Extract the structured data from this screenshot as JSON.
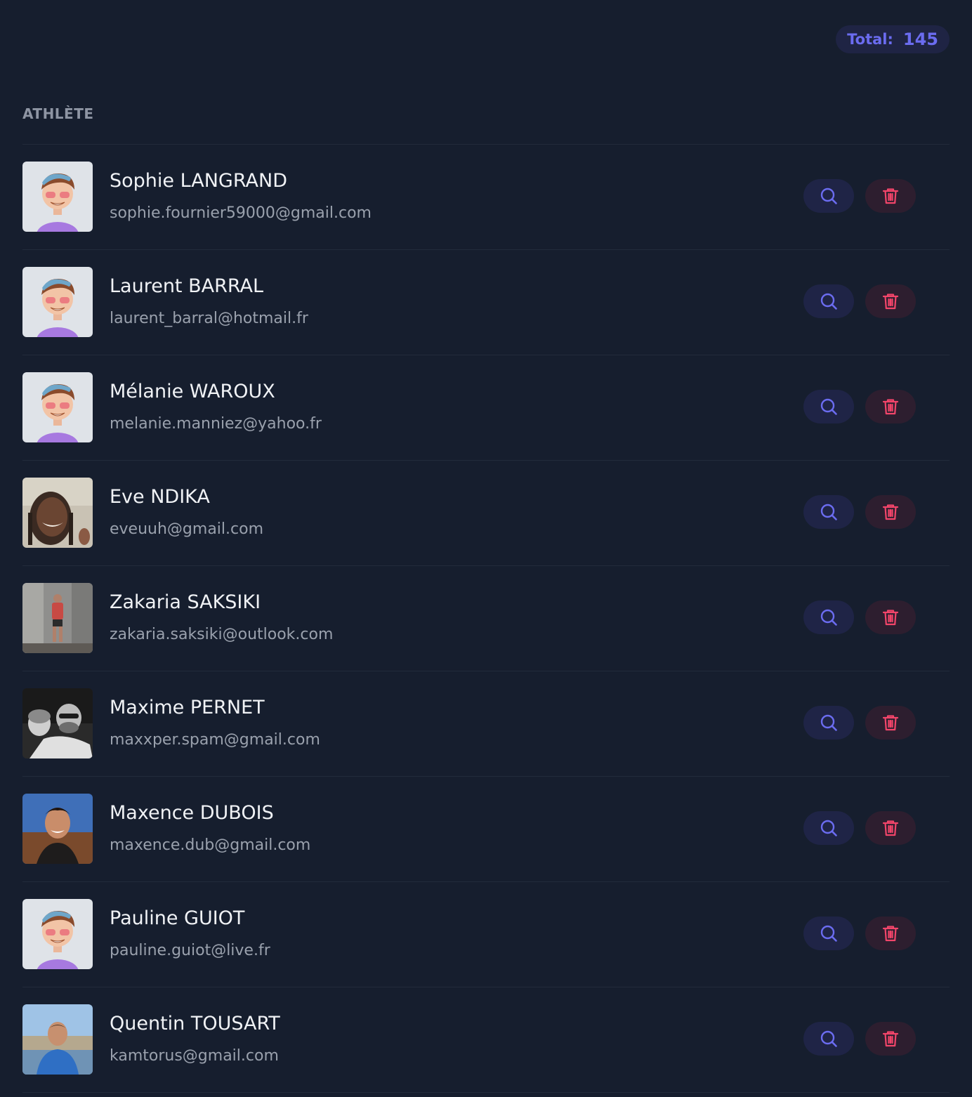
{
  "header": {
    "total_label": "Total:",
    "total_value": "145",
    "column_label": "ATHLÈTE"
  },
  "colors": {
    "background": "#161e2e",
    "accent": "#6b6cf0",
    "danger": "#f2456a"
  },
  "athletes": [
    {
      "name": "Sophie LANGRAND",
      "email": "sophie.fournier59000@gmail.com",
      "avatar": "cartoon-default"
    },
    {
      "name": "Laurent BARRAL",
      "email": "laurent_barral@hotmail.fr",
      "avatar": "cartoon-default"
    },
    {
      "name": "Mélanie WAROUX",
      "email": "melanie.manniez@yahoo.fr",
      "avatar": "cartoon-default"
    },
    {
      "name": "Eve NDIKA",
      "email": "eveuuh@gmail.com",
      "avatar": "photo"
    },
    {
      "name": "Zakaria SAKSIKI",
      "email": "zakaria.saksiki@outlook.com",
      "avatar": "photo"
    },
    {
      "name": "Maxime PERNET",
      "email": "maxxper.spam@gmail.com",
      "avatar": "photo-bw"
    },
    {
      "name": "Maxence DUBOIS",
      "email": "maxence.dub@gmail.com",
      "avatar": "photo"
    },
    {
      "name": "Pauline GUIOT",
      "email": "pauline.guiot@live.fr",
      "avatar": "cartoon-default"
    },
    {
      "name": "Quentin TOUSART",
      "email": "kamtorus@gmail.com",
      "avatar": "photo"
    }
  ],
  "icons": {
    "view": "search-icon",
    "delete": "trash-icon"
  }
}
